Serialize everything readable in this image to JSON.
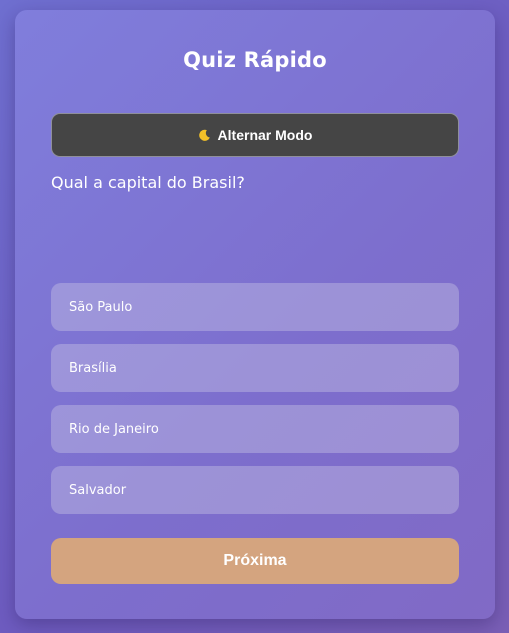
{
  "quiz": {
    "title": "Quiz Rápido",
    "mode_toggle": {
      "icon": "moon-icon",
      "label": "Alternar Modo"
    },
    "question": "Qual a capital do Brasil?",
    "options": [
      {
        "label": "São Paulo"
      },
      {
        "label": "Brasília"
      },
      {
        "label": "Rio de Janeiro"
      },
      {
        "label": "Salvador"
      }
    ],
    "next_label": "Próxima"
  },
  "colors": {
    "background": "#6e5cc0",
    "card": "#807edc",
    "toggle_background": "#454545",
    "next_button": "#d4a47f",
    "moon": "#f2c028"
  }
}
